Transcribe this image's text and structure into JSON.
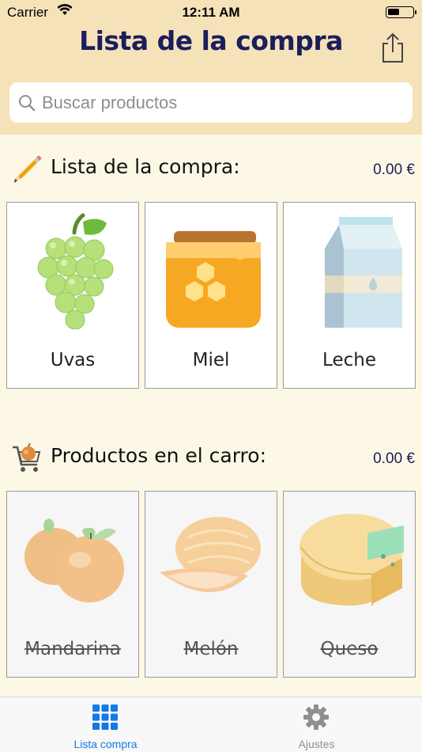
{
  "status_bar": {
    "carrier": "Carrier",
    "time": "12:11 AM"
  },
  "header": {
    "title": "Lista de la compra",
    "share_icon": "share-icon"
  },
  "search": {
    "placeholder": "Buscar productos",
    "value": ""
  },
  "shopping_list": {
    "title": "Lista de la compra:",
    "total": "0.00 €",
    "icon": "pencil-icon",
    "items": [
      {
        "label": "Uvas",
        "icon": "grapes-icon"
      },
      {
        "label": "Miel",
        "icon": "honey-jar-icon"
      },
      {
        "label": "Leche",
        "icon": "milk-carton-icon"
      }
    ]
  },
  "cart": {
    "title": "Productos en el carro:",
    "total": "0.00 €",
    "icon": "shopping-cart-icon",
    "items": [
      {
        "label": "Mandarina",
        "icon": "mandarin-icon"
      },
      {
        "label": "Melón",
        "icon": "melon-icon"
      },
      {
        "label": "Queso",
        "icon": "cheese-icon"
      }
    ]
  },
  "tabbar": {
    "tabs": [
      {
        "label": "Lista compra",
        "icon": "grid-icon",
        "active": true
      },
      {
        "label": "Ajustes",
        "icon": "gear-icon",
        "active": false
      }
    ]
  },
  "colors": {
    "header_bg": "#f6e2b9",
    "page_bg": "#fdf8e6",
    "title": "#1a1e5c",
    "tab_active": "#1479e6"
  }
}
